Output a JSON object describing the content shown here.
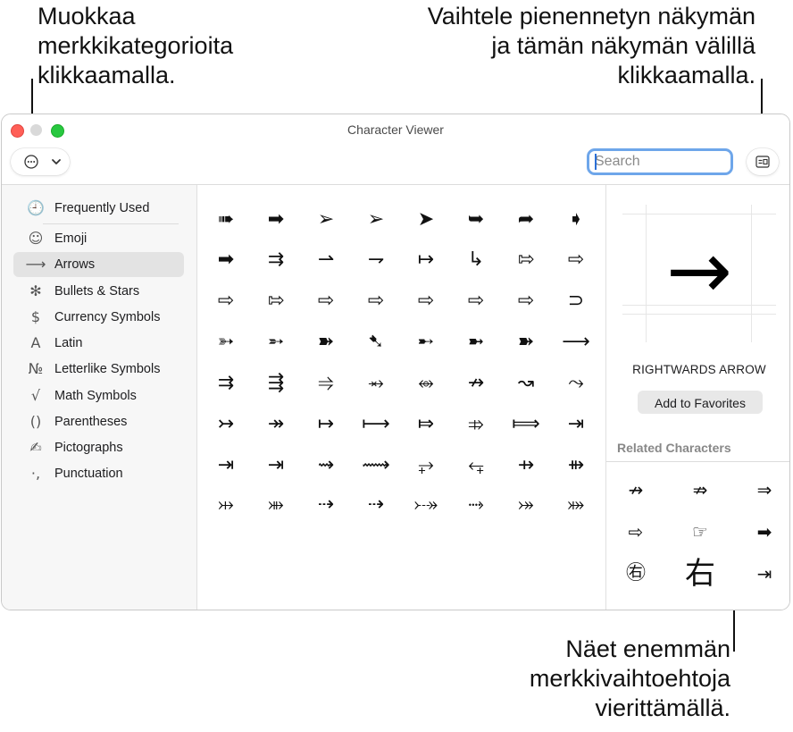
{
  "callouts": {
    "left": "Muokkaa\nmerkkikategorioita\nklikkaamalla.",
    "right": "Vaihtele pienennetyn näkymän\nja tämän näkymän välillä\nklikkaamalla.",
    "bottom": "Näet enemmän\nmerkkivaihtoehtoja\nvierittämällä."
  },
  "window": {
    "title": "Character Viewer",
    "search_placeholder": "Search"
  },
  "toolbar": {
    "category_icon": "ellipsis-circle-icon",
    "chevron_icon": "chevron-down-icon",
    "view_toggle_icon": "compact-view-icon"
  },
  "sidebar": {
    "items": [
      {
        "icon": "🕘",
        "icon_name": "clock-icon",
        "label": "Frequently Used"
      },
      {
        "icon": "☺",
        "icon_name": "smiley-icon",
        "label": "Emoji"
      },
      {
        "icon": "⟶",
        "icon_name": "arrow-icon",
        "label": "Arrows"
      },
      {
        "icon": "✻",
        "icon_name": "asterisk-icon",
        "label": "Bullets & Stars"
      },
      {
        "icon": "$",
        "icon_name": "dollar-icon",
        "label": "Currency Symbols"
      },
      {
        "icon": "A",
        "icon_name": "letter-a-icon",
        "label": "Latin"
      },
      {
        "icon": "№",
        "icon_name": "numero-icon",
        "label": "Letterlike Symbols"
      },
      {
        "icon": "√",
        "icon_name": "square-root-icon",
        "label": "Math Symbols"
      },
      {
        "icon": "()",
        "icon_name": "parentheses-icon",
        "label": "Parentheses"
      },
      {
        "icon": "✍",
        "icon_name": "pictograph-icon",
        "label": "Pictographs"
      },
      {
        "icon": "·,",
        "icon_name": "punctuation-icon",
        "label": "Punctuation"
      }
    ],
    "selected_index": 2
  },
  "grid": {
    "selected_index": 0,
    "characters": [
      "➞",
      "⇛",
      "⟹",
      "⇨",
      "⇾",
      "⋙",
      "⇢",
      "☛",
      "☞",
      "➔",
      "➜",
      "➛",
      "➣",
      "⟶",
      "➞",
      "➡",
      "➠",
      "➡",
      "➢",
      "➢",
      "➤",
      "➥",
      "➦",
      "➧",
      "➡",
      "⇉",
      "⇀",
      "⇁",
      "↦",
      "↳",
      "⇰",
      "⇨",
      "⇨",
      "⇰",
      "⇨",
      "⇨",
      "⇨",
      "⇨",
      "⇨",
      "⊃",
      "➳",
      "➵",
      "➽",
      "➷",
      "➸",
      "➼",
      "➽",
      "⟶",
      "⇉",
      "⇶",
      "⥤",
      "⥇",
      "⥈",
      "↛",
      "↝",
      "⤳",
      "↣",
      "↠",
      "↦",
      "⟼",
      "⤇",
      "⤃",
      "⟾",
      "⇥",
      "⇥",
      "⇥",
      "⇝",
      "⟿",
      "⥅",
      "⥆",
      "⇸",
      "⇻",
      "⤔",
      "⤕",
      "⇢",
      "⇢",
      "⤐",
      "⤑",
      "⤖",
      "⤗"
    ]
  },
  "info": {
    "preview_char": "→",
    "char_name": "RIGHTWARDS ARROW",
    "favorites_label": "Add to Favorites",
    "related_title": "Related Characters",
    "related": [
      "↛",
      "⇏",
      "⇒",
      "⇨",
      "☞",
      "➡",
      "㊨",
      "右",
      "⇥"
    ]
  }
}
